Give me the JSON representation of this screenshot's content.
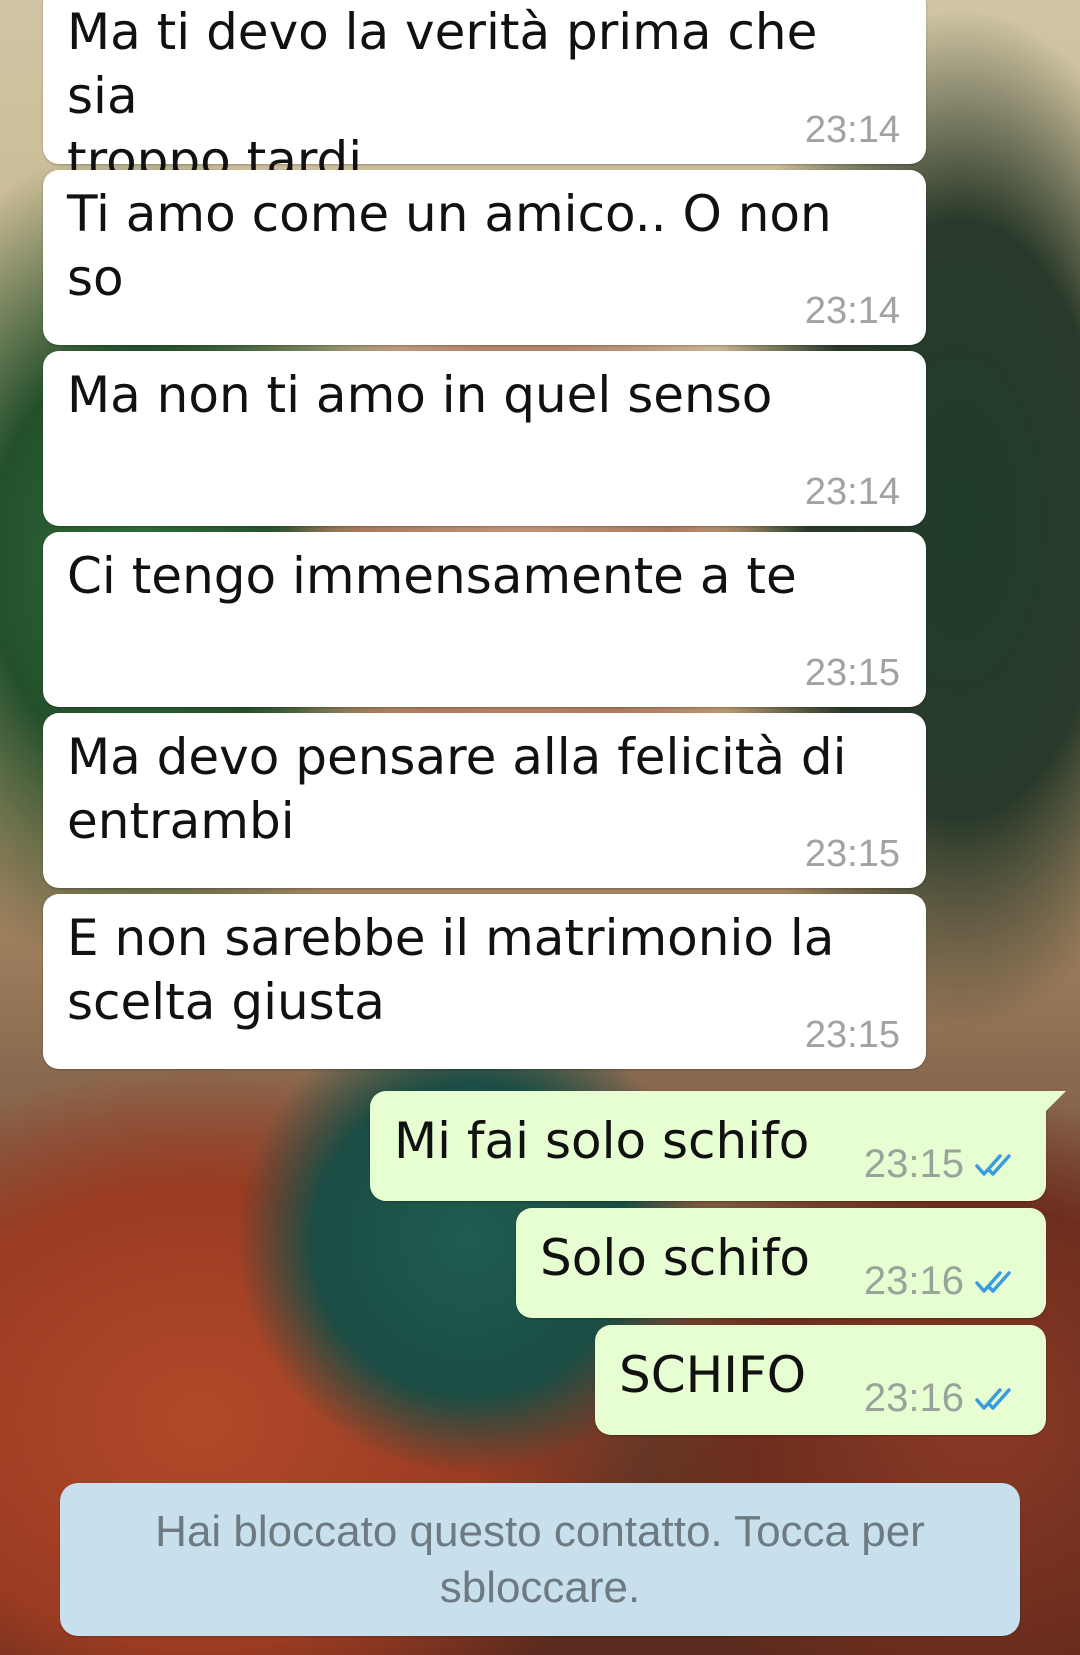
{
  "messages_incoming": [
    {
      "text": "Ma ti devo la verità prima che sia\ntroppo tardi",
      "time": "23:14"
    },
    {
      "text": "Ti amo come un amico.. O non so",
      "time": "23:14"
    },
    {
      "text": "Ma non ti amo in quel senso",
      "time": "23:14"
    },
    {
      "text": "Ci tengo immensamente a te",
      "time": "23:15"
    },
    {
      "text": "Ma devo pensare alla felicità di\nentrambi",
      "time": "23:15"
    },
    {
      "text": "E non sarebbe il matrimonio la\nscelta giusta",
      "time": "23:15"
    }
  ],
  "messages_outgoing": [
    {
      "text": "Mi fai solo schifo",
      "time": "23:15",
      "status_icon": "double-check-read-icon"
    },
    {
      "text": "Solo schifo",
      "time": "23:16",
      "status_icon": "double-check-read-icon"
    },
    {
      "text": "SCHIFO",
      "time": "23:16",
      "status_icon": "double-check-read-icon"
    }
  ],
  "blocked_notice": "Hai bloccato questo contatto. Tocca per sbloccare.",
  "colors": {
    "incoming_bubble": "#ffffff",
    "outgoing_bubble": "#e7fed3",
    "read_ticks": "#3a9be0",
    "notice_bg": "#c8e0ee"
  }
}
